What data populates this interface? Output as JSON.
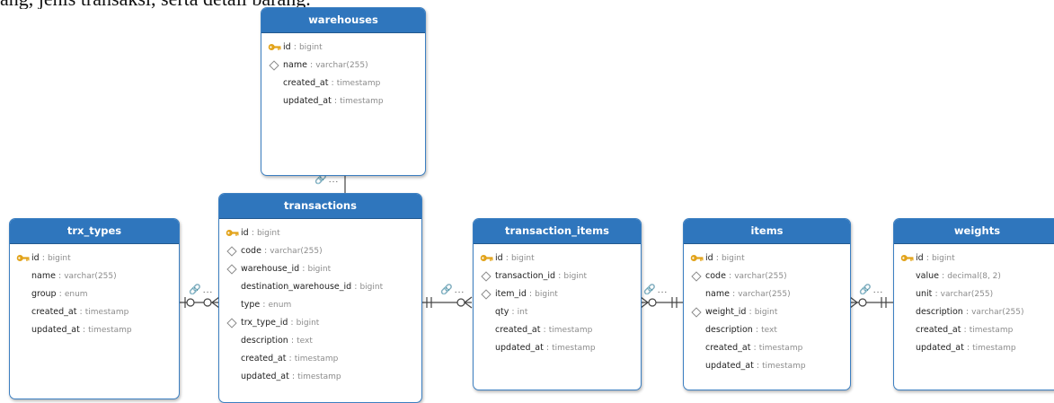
{
  "caption_fragment": "ang, jenis transaksi, serta detail barang.",
  "sep": ":",
  "link_ellipsis": "...",
  "entities": {
    "warehouses": {
      "title": "warehouses",
      "fields": [
        {
          "name": "id",
          "type": "bigint",
          "key": "pk"
        },
        {
          "name": "name",
          "type": "varchar(255)",
          "key": "index"
        },
        {
          "name": "created_at",
          "type": "timestamp",
          "key": ""
        },
        {
          "name": "updated_at",
          "type": "timestamp",
          "key": ""
        }
      ]
    },
    "transactions": {
      "title": "transactions",
      "fields": [
        {
          "name": "id",
          "type": "bigint",
          "key": "pk"
        },
        {
          "name": "code",
          "type": "varchar(255)",
          "key": "index"
        },
        {
          "name": "warehouse_id",
          "type": "bigint",
          "key": "index"
        },
        {
          "name": "destination_warehouse_id",
          "type": "bigint",
          "key": ""
        },
        {
          "name": "type",
          "type": "enum",
          "key": ""
        },
        {
          "name": "trx_type_id",
          "type": "bigint",
          "key": "index"
        },
        {
          "name": "description",
          "type": "text",
          "key": ""
        },
        {
          "name": "created_at",
          "type": "timestamp",
          "key": ""
        },
        {
          "name": "updated_at",
          "type": "timestamp",
          "key": ""
        }
      ]
    },
    "trx_types": {
      "title": "trx_types",
      "fields": [
        {
          "name": "id",
          "type": "bigint",
          "key": "pk"
        },
        {
          "name": "name",
          "type": "varchar(255)",
          "key": ""
        },
        {
          "name": "group",
          "type": "enum",
          "key": ""
        },
        {
          "name": "created_at",
          "type": "timestamp",
          "key": ""
        },
        {
          "name": "updated_at",
          "type": "timestamp",
          "key": ""
        }
      ]
    },
    "transaction_items": {
      "title": "transaction_items",
      "fields": [
        {
          "name": "id",
          "type": "bigint",
          "key": "pk"
        },
        {
          "name": "transaction_id",
          "type": "bigint",
          "key": "index"
        },
        {
          "name": "item_id",
          "type": "bigint",
          "key": "index"
        },
        {
          "name": "qty",
          "type": "int",
          "key": ""
        },
        {
          "name": "created_at",
          "type": "timestamp",
          "key": ""
        },
        {
          "name": "updated_at",
          "type": "timestamp",
          "key": ""
        }
      ]
    },
    "items": {
      "title": "items",
      "fields": [
        {
          "name": "id",
          "type": "bigint",
          "key": "pk"
        },
        {
          "name": "code",
          "type": "varchar(255)",
          "key": "index"
        },
        {
          "name": "name",
          "type": "varchar(255)",
          "key": ""
        },
        {
          "name": "weight_id",
          "type": "bigint",
          "key": "index"
        },
        {
          "name": "description",
          "type": "text",
          "key": ""
        },
        {
          "name": "created_at",
          "type": "timestamp",
          "key": ""
        },
        {
          "name": "updated_at",
          "type": "timestamp",
          "key": ""
        }
      ]
    },
    "weights": {
      "title": "weights",
      "fields": [
        {
          "name": "id",
          "type": "bigint",
          "key": "pk"
        },
        {
          "name": "value",
          "type": "decimal(8, 2)",
          "key": ""
        },
        {
          "name": "unit",
          "type": "varchar(255)",
          "key": ""
        },
        {
          "name": "description",
          "type": "varchar(255)",
          "key": ""
        },
        {
          "name": "created_at",
          "type": "timestamp",
          "key": ""
        },
        {
          "name": "updated_at",
          "type": "timestamp",
          "key": ""
        }
      ]
    }
  },
  "colors": {
    "header": "#2f76bd",
    "border": "#3c7fc1",
    "key_icon": "#e2a31a",
    "line": "#444444"
  },
  "icons": {
    "primary_key": "key-icon",
    "index": "diamond-icon",
    "relationship": "link-icon"
  }
}
